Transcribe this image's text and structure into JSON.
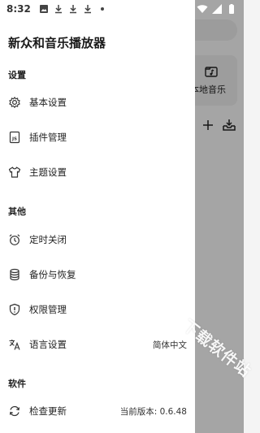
{
  "status_bar": {
    "time": "8:32"
  },
  "app": {
    "title": "新众和音乐播放器"
  },
  "background": {
    "card_label": "本地音乐"
  },
  "sections": {
    "settings": "设置",
    "other": "其他",
    "software": "软件"
  },
  "menu": {
    "basic_settings": "基本设置",
    "plugin_management": "插件管理",
    "theme_settings": "主题设置",
    "timer_close": "定时关闭",
    "backup_restore": "备份与恢复",
    "permission_management": "权限管理",
    "language_settings": "语言设置",
    "language_value": "简体中文",
    "check_update": "检查更新",
    "version_value": "当前版本: 0.6.48"
  },
  "watermark": "下载软件站",
  "icons": {
    "basic_settings": "gear-icon",
    "plugin_management": "js-file-icon",
    "theme_settings": "shirt-icon",
    "timer_close": "alarm-clock-icon",
    "backup_restore": "database-icon",
    "permission_management": "shield-icon",
    "language_settings": "translate-icon",
    "check_update": "refresh-icon"
  }
}
